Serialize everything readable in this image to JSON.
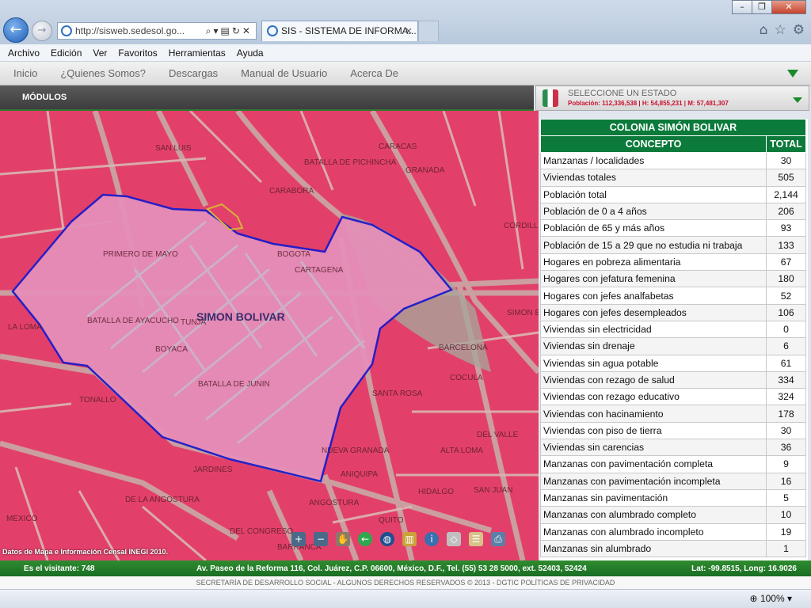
{
  "browser": {
    "address": "http://sisweb.sedesol.go...",
    "tab_title": "SIS - SISTEMA DE INFORMA...",
    "tab_close": "×",
    "menu": [
      "Archivo",
      "Edición",
      "Ver",
      "Favoritos",
      "Herramientas",
      "Ayuda"
    ],
    "zoom": "100%"
  },
  "site_nav": [
    "Inicio",
    "¿Quienes Somos?",
    "Descargas",
    "Manual de Usuario",
    "Acerca De"
  ],
  "modulos_label": "MÓDULOS",
  "estado": {
    "label": "SELECCIONE UN ESTADO",
    "population": "Población: 112,336,538 | H: 54,855,231 | M: 57,481,307"
  },
  "map": {
    "colonia_label": "SIMON BOLIVAR",
    "credit": "Datos de Mapa e Información Censal INEGI 2010.",
    "street_labels": [
      "SAN LUIS",
      "CARABORA",
      "BATALLA DE PICHINCHA",
      "CARACAS",
      "GRANADA",
      "PRIMERO DE MAYO",
      "BATALLA DE AYACUCHO",
      "TUNJA",
      "BOYACA",
      "BOGOTA",
      "CARTAGENA",
      "LA LOMA",
      "TONALLO",
      "JARDINES",
      "DE LA ANGOSTURA",
      "DEL CONGRESO",
      "BARCELONA",
      "COCULA",
      "NUEVA GRANADA",
      "ANIQUIPA",
      "HIDALGO",
      "SAN JUAN",
      "SIMON BOLIVAR",
      "CORDILLERA",
      "ALTA LOMA",
      "DEL VALLE",
      "QUITO",
      "BARRANCA",
      "MEXICO",
      "SANTA ROSA",
      "ANGOSTURA",
      "BATALLA DE JUNIN"
    ]
  },
  "table": {
    "title": "COLONIA SIMÓN BOLIVAR",
    "headers": [
      "CONCEPTO",
      "TOTAL"
    ],
    "rows": [
      [
        "Manzanas / localidades",
        "30"
      ],
      [
        "Viviendas totales",
        "505"
      ],
      [
        "Población total",
        "2,144"
      ],
      [
        "Población de 0 a 4 años",
        "206"
      ],
      [
        "Población de 65 y más años",
        "93"
      ],
      [
        "Población de 15 a 29 que no estudia ni trabaja",
        "133"
      ],
      [
        "Hogares en pobreza alimentaria",
        "67"
      ],
      [
        "Hogares con jefatura femenina",
        "180"
      ],
      [
        "Hogares con jefes analfabetas",
        "52"
      ],
      [
        "Hogares con jefes desempleados",
        "106"
      ],
      [
        "Viviendas sin electricidad",
        "0"
      ],
      [
        "Viviendas sin drenaje",
        "6"
      ],
      [
        "Viviendas sin agua potable",
        "61"
      ],
      [
        "Viviendas con rezago de salud",
        "334"
      ],
      [
        "Viviendas con rezago educativo",
        "324"
      ],
      [
        "Viviendas con hacinamiento",
        "178"
      ],
      [
        "Viviendas con piso de tierra",
        "30"
      ],
      [
        "Viviendas sin carencias",
        "36"
      ],
      [
        "Manzanas con pavimentación completa",
        "9"
      ],
      [
        "Manzanas con pavimentación incompleta",
        "16"
      ],
      [
        "Manzanas sin pavimentación",
        "5"
      ],
      [
        "Manzanas con alumbrado completo",
        "10"
      ],
      [
        "Manzanas con alumbrado incompleto",
        "19"
      ],
      [
        "Manzanas sin alumbrado",
        "1"
      ]
    ]
  },
  "footer": {
    "visitor": "Es el visitante: 748",
    "address": "Av. Paseo de la Reforma 116, Col. Juárez, C.P. 06600, México, D.F., Tel. (55) 53 28 5000, ext. 52403, 52424",
    "coords": "Lat: -99.8515, Long: 16.9026",
    "copyright": "SECRETARÍA DE DESARROLLO SOCIAL - ALGUNOS DERECHOS RESERVADOS © 2013 - DGTIC POLÍTICAS DE PRIVACIDAD"
  },
  "colors": {
    "map_fill": "#e2406a",
    "polygon_fill": "#e58fb8",
    "polygon_stroke": "#1c1ccc",
    "header_green": "#0b7a3a"
  }
}
